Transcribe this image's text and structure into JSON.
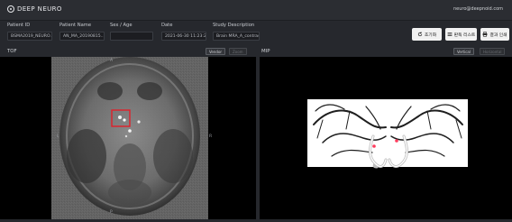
{
  "header": {
    "logo_text": "DEEP NEURO",
    "user_email": "neuro@deepnoid.com"
  },
  "patient": {
    "id_label": "Patient ID",
    "id_value": "BSMA2019_NEURO...",
    "name_label": "Patient Name",
    "name_value": "AN_MA_20190815...",
    "sexage_label": "Sex / Age",
    "sexage_value": "",
    "date_label": "Date",
    "date_value": "2021-06-30 11:23:25",
    "study_label": "Study Description",
    "study_value": "Brain MRA_A_contrast"
  },
  "actions": {
    "reset_label": "초기화",
    "send_label": "판독 리스트",
    "print_label": "결과 인쇄"
  },
  "tof": {
    "title": "TOF",
    "tool1": "Vendor",
    "tool2": "Zoom",
    "orient_top": "A",
    "orient_left": "L",
    "orient_right": "R",
    "orient_bottom": "P"
  },
  "mip": {
    "title": "MIP",
    "tool1": "Vertical",
    "tool2": "Horizontal"
  },
  "icons": {
    "reset": "refresh-icon",
    "send": "list-icon",
    "print": "printer-icon"
  },
  "colors": {
    "background": "#26282d",
    "viewer_bg": "#000000",
    "highlight": "#e0202a"
  }
}
